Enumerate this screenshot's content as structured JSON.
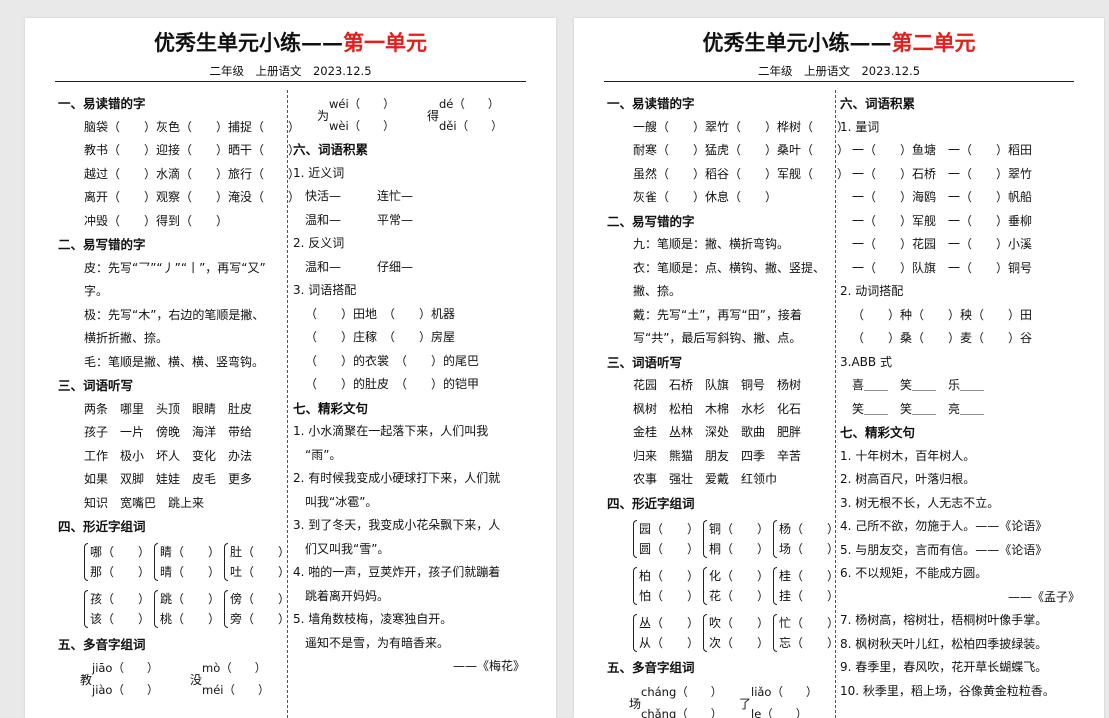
{
  "pages": [
    {
      "title_main": "优秀生单元小练——",
      "title_red": "第一单元",
      "subtitle": "二年级　上册语文　2023.12.5",
      "left": [
        {
          "type": "h",
          "text": "一、易读错的字"
        },
        {
          "type": "l",
          "text": "脑袋（　　）灰色（　　）捕捉（　　）"
        },
        {
          "type": "l",
          "text": "教书（　　）迎接（　　）晒干（　　）"
        },
        {
          "type": "l",
          "text": "越过（　　）水滴（　　）旅行（　　）"
        },
        {
          "type": "l",
          "text": "离开（　　）观察（　　）淹没（　　）"
        },
        {
          "type": "l",
          "text": "冲毁（　　）得到（　　）"
        },
        {
          "type": "h",
          "text": "二、易写错的字"
        },
        {
          "type": "l",
          "text": "皮：先写“乛”“丿”“丨”，再写“又”"
        },
        {
          "type": "l",
          "text": "字。"
        },
        {
          "type": "l",
          "text": "极：先写“木”，右边的笔顺是撇、"
        },
        {
          "type": "l",
          "text": "横折折撇、捺。"
        },
        {
          "type": "l",
          "text": "毛：笔顺是撇、横、横、竖弯钩。"
        },
        {
          "type": "h",
          "text": "三、词语听写"
        },
        {
          "type": "l",
          "text": "两条　哪里　头顶　眼睛　肚皮"
        },
        {
          "type": "l",
          "text": "孩子　一片　傍晚　海洋　带给"
        },
        {
          "type": "l",
          "text": "工作　极小　坏人　变化　办法"
        },
        {
          "type": "l",
          "text": "如果　双脚　娃娃　皮毛　更多"
        },
        {
          "type": "l",
          "text": "知识　宽嘴巴　跳上来"
        },
        {
          "type": "h",
          "text": "四、形近字组词"
        },
        {
          "type": "b",
          "a": "哪（　　）",
          "b": "那（　　）",
          "c": "睛（　　）",
          "d": "晴（　　）",
          "e": "肚（　　）",
          "f": "吐（　　）"
        },
        {
          "type": "b",
          "a": "孩（　　）",
          "b": "该（　　）",
          "c": "跳（　　）",
          "d": "桃（　　）",
          "e": "傍（　　）",
          "f": "旁（　　）"
        },
        {
          "type": "h",
          "text": "五、多音字组词"
        },
        {
          "type": "p",
          "c1": "教",
          "t1": "jiāo（　　）",
          "b1": "jiào（　　）",
          "c2": "没",
          "t2": "mò（　　）",
          "b2": "méi（　　）"
        }
      ],
      "right": [
        {
          "type": "p",
          "c1": "为",
          "t1": "wéi（　　）",
          "b1": "wèi（　　）",
          "c2": "得",
          "t2": "dé（　　）",
          "b2": "děi（　　）"
        },
        {
          "type": "h",
          "text": "六、词语积累"
        },
        {
          "type": "l",
          "text": "1. 近义词"
        },
        {
          "type": "l2",
          "text": "快活—　　　连忙—"
        },
        {
          "type": "l2",
          "text": "温和—　　　平常—"
        },
        {
          "type": "l",
          "text": "2. 反义词"
        },
        {
          "type": "l2",
          "text": "温和—　　　仔细—"
        },
        {
          "type": "l",
          "text": "3. 词语搭配"
        },
        {
          "type": "l2",
          "text": "（　　）田地　（　　）机器"
        },
        {
          "type": "l2",
          "text": "（　　）庄稼　（　　）房屋"
        },
        {
          "type": "l2",
          "text": "（　　）的衣裳　（　　）的尾巴"
        },
        {
          "type": "l2",
          "text": "（　　）的肚皮　（　　）的铠甲"
        },
        {
          "type": "h",
          "text": "七、精彩文句"
        },
        {
          "type": "l",
          "text": "1. 小水滴聚在一起落下来，人们叫我"
        },
        {
          "type": "l2",
          "text": "“雨”。"
        },
        {
          "type": "l",
          "text": "2. 有时候我变成小硬球打下来，人们就"
        },
        {
          "type": "l2",
          "text": "叫我“冰雹”。"
        },
        {
          "type": "l",
          "text": "3. 到了冬天，我变成小花朵飘下来，人"
        },
        {
          "type": "l2",
          "text": "们又叫我“雪”。"
        },
        {
          "type": "l",
          "text": "4. 啪的一声，豆荚炸开，孩子们就蹦着"
        },
        {
          "type": "l2",
          "text": "跳着离开妈妈。"
        },
        {
          "type": "l",
          "text": "5. 墙角数枝梅，凌寒独自开。"
        },
        {
          "type": "l2",
          "text": "遥知不是雪，为有暗香来。"
        },
        {
          "type": "r",
          "text": "——《梅花》"
        }
      ]
    },
    {
      "title_main": "优秀生单元小练——",
      "title_red": "第二单元",
      "subtitle": "二年级　上册语文　2023.12.5",
      "left": [
        {
          "type": "h",
          "text": "一、易读错的字"
        },
        {
          "type": "l",
          "text": "一艘（　　）翠竹（　　）桦树（　　）"
        },
        {
          "type": "l",
          "text": "耐寒（　　）猛虎（　　）桑叶（　　）"
        },
        {
          "type": "l",
          "text": "虽然（　　）稻谷（　　）军舰（　　）"
        },
        {
          "type": "l",
          "text": "灰雀（　　）休息（　　）"
        },
        {
          "type": "h",
          "text": "二、易写错的字"
        },
        {
          "type": "l",
          "text": "九：笔顺是：撇、横折弯钩。"
        },
        {
          "type": "l",
          "text": "衣：笔顺是：点、横钩、撇、竖提、"
        },
        {
          "type": "l",
          "text": "撇、捺。"
        },
        {
          "type": "l",
          "text": "戴：先写“土”，再写“田”，接着"
        },
        {
          "type": "l",
          "text": "写“共”，最后写斜钩、撇、点。"
        },
        {
          "type": "h",
          "text": "三、词语听写"
        },
        {
          "type": "l",
          "text": "花园　石桥　队旗　铜号　杨树"
        },
        {
          "type": "l",
          "text": "枫树　松柏　木棉　水杉　化石"
        },
        {
          "type": "l",
          "text": "金桂　丛林　深处　歌曲　肥胖"
        },
        {
          "type": "l",
          "text": "归来　熊猫　朋友　四季　辛苦"
        },
        {
          "type": "l",
          "text": "农事　强壮　爱戴　红领巾"
        },
        {
          "type": "h",
          "text": "四、形近字组词"
        },
        {
          "type": "b",
          "a": "园（　　）",
          "b": "圆（　　）",
          "c": "铜（　　）",
          "d": "桐（　　）",
          "e": "杨（　　）",
          "f": "场（　　）"
        },
        {
          "type": "b",
          "a": "柏（　　）",
          "b": "怕（　　）",
          "c": "化（　　）",
          "d": "花（　　）",
          "e": "桂（　　）",
          "f": "挂（　　）"
        },
        {
          "type": "b",
          "a": "丛（　　）",
          "b": "从（　　）",
          "c": "吹（　　）",
          "d": "次（　　）",
          "e": "忙（　　）",
          "f": "忘（　　）"
        },
        {
          "type": "h",
          "text": "五、多音字组词"
        },
        {
          "type": "p",
          "c1": "场",
          "t1": "cháng（　　）",
          "b1": "chǎng（　　）",
          "c2": "了",
          "t2": "liǎo（　　）",
          "b2": "le（　　）"
        }
      ],
      "right": [
        {
          "type": "h",
          "text": "六、词语积累"
        },
        {
          "type": "l",
          "text": "1. 量词"
        },
        {
          "type": "l2",
          "text": "一（　　）鱼塘　一（　　）稻田"
        },
        {
          "type": "l2",
          "text": "一（　　）石桥　一（　　）翠竹"
        },
        {
          "type": "l2",
          "text": "一（　　）海鸥　一（　　）帆船"
        },
        {
          "type": "l2",
          "text": "一（　　）军舰　一（　　）垂柳"
        },
        {
          "type": "l2",
          "text": "一（　　）花园　一（　　）小溪"
        },
        {
          "type": "l2",
          "text": "一（　　）队旗　一（　　）铜号"
        },
        {
          "type": "l",
          "text": "2. 动词搭配"
        },
        {
          "type": "l2",
          "text": "（　　）种（　　）秧（　　）田"
        },
        {
          "type": "l2",
          "text": "（　　）桑（　　）麦（　　）谷"
        },
        {
          "type": "l",
          "text": "3.ABB 式"
        },
        {
          "type": "l2",
          "text": "喜＿＿　笑＿＿　乐＿＿"
        },
        {
          "type": "l2",
          "text": "笑＿＿　笑＿＿　亮＿＿"
        },
        {
          "type": "h",
          "text": "七、精彩文句"
        },
        {
          "type": "l",
          "text": "1. 十年树木，百年树人。"
        },
        {
          "type": "l",
          "text": "2. 树高百尺，叶落归根。"
        },
        {
          "type": "l",
          "text": "3. 树无根不长，人无志不立。"
        },
        {
          "type": "l",
          "text": "4. 己所不欲，勿施于人。——《论语》"
        },
        {
          "type": "l",
          "text": "5. 与朋友交，言而有信。——《论语》"
        },
        {
          "type": "l",
          "text": "6. 不以规矩，不能成方圆。"
        },
        {
          "type": "r",
          "text": "——《孟子》"
        },
        {
          "type": "l",
          "text": "7. 杨树高，榕树壮，梧桐树叶像手掌。"
        },
        {
          "type": "l",
          "text": "8. 枫树秋天叶儿红，松柏四季披绿装。"
        },
        {
          "type": "l",
          "text": "9. 春季里，春风吹，花开草长蝴蝶飞。"
        },
        {
          "type": "l",
          "text": "10. 秋季里，稻上场，谷像黄金粒粒香。"
        }
      ]
    }
  ]
}
